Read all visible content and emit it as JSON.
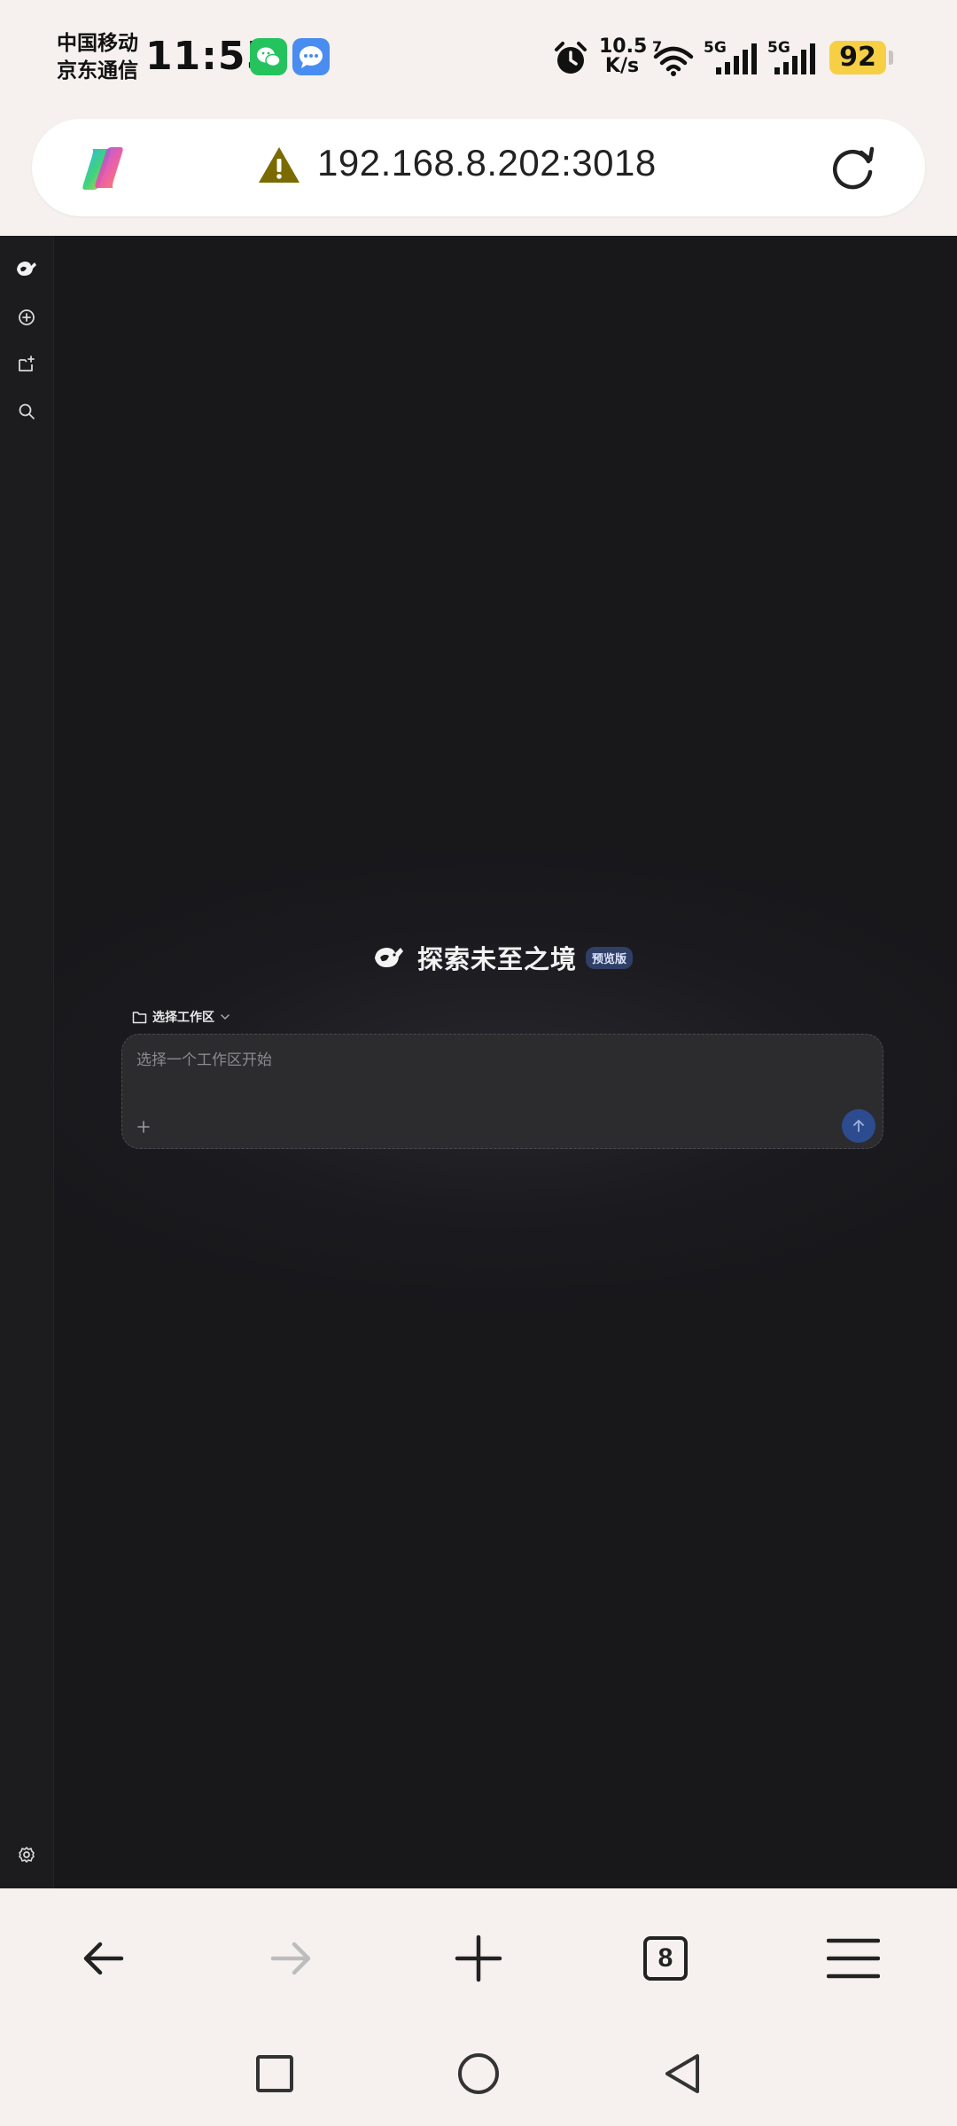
{
  "status_bar": {
    "carrier_line1": "中国移动",
    "carrier_line2": "京东通信",
    "time": "11:55",
    "net_speed_value": "10.5",
    "net_speed_unit": "K/s",
    "signal1_label": "5G",
    "signal2_label": "5G",
    "wifi_label": "7",
    "battery_level": "92",
    "icons": [
      "wechat-icon",
      "message-icon",
      "alarm-icon",
      "wifi-icon",
      "signal-icon",
      "battery-icon"
    ]
  },
  "browser": {
    "url": "192.168.8.202:3018",
    "tabs_count": "8",
    "security": "not-secure",
    "accent_warning": "#7a6a00"
  },
  "app": {
    "hero_title": "探索未至之境",
    "preview_badge": "预览版",
    "workspace_label": "选择工作区",
    "prompt_placeholder": "选择一个工作区开始",
    "sidebar_items": [
      "logo",
      "new-chat",
      "new-folder",
      "search"
    ],
    "colors": {
      "background": "#18181b",
      "sidebar": "#1c1c1e",
      "send_button": "#2d4b8f",
      "badge": "#2f3f66"
    }
  }
}
